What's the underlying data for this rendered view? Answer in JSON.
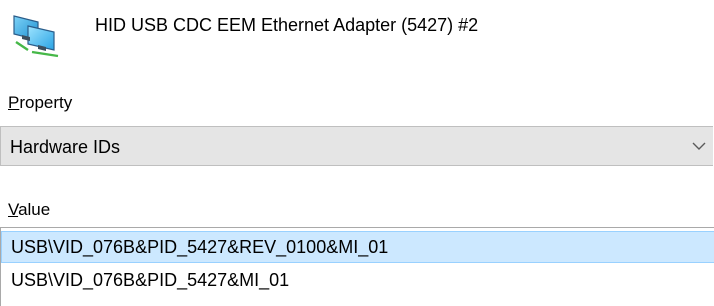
{
  "device": {
    "icon": "network-adapter-icon",
    "name": "HID USB CDC EEM Ethernet Adapter (5427) #2"
  },
  "property": {
    "label_mnemonic": "P",
    "label_rest": "roperty",
    "selected": "Hardware IDs",
    "arrow_icon": "chevron-down-icon"
  },
  "value": {
    "label_mnemonic": "V",
    "label_rest": "alue",
    "items": [
      {
        "text": "USB\\VID_076B&PID_5427&REV_0100&MI_01",
        "selected": true
      },
      {
        "text": "USB\\VID_076B&PID_5427&MI_01",
        "selected": false
      }
    ]
  },
  "colors": {
    "selection_fill": "#cce8ff",
    "selection_border": "#99d1ff",
    "combo_background": "#e5e5e5"
  }
}
